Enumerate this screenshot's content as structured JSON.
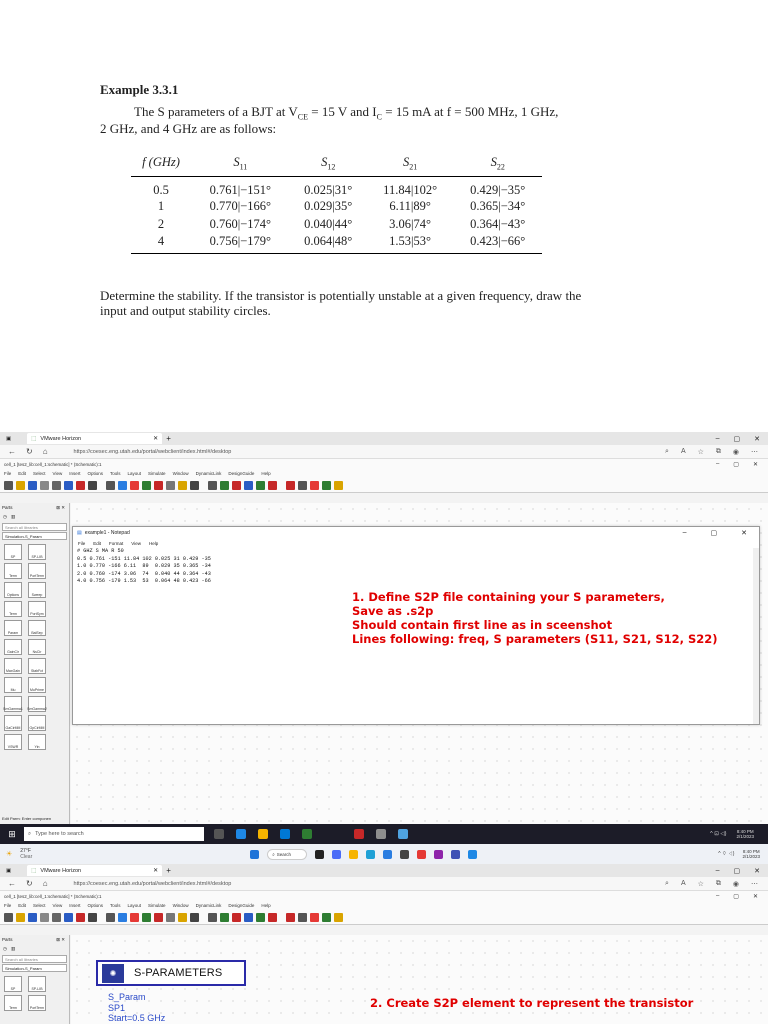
{
  "example": {
    "title": "Example 3.3.1",
    "intro_line1": "The S parameters of a BJT at V",
    "intro_vce_sub": "CE",
    "intro_mid": " = 15 V and I",
    "intro_ic_sub": "C",
    "intro_end": " = 15 mA at f = 500 MHz, 1 GHz,",
    "intro_line2": "2 GHz, and 4 GHz are as follows:",
    "table": {
      "headers": [
        "f (GHz)",
        "S11",
        "S12",
        "S21",
        "S22"
      ],
      "rows": [
        [
          "0.5",
          "0.761|−151°",
          "0.025|31°",
          "11.84|102°",
          "0.429|−35°"
        ],
        [
          "1",
          "0.770|−166°",
          "0.029|35°",
          "6.11|89°",
          "0.365|−34°"
        ],
        [
          "2",
          "0.760|−174°",
          "0.040|44°",
          "3.06|74°",
          "0.364|−43°"
        ],
        [
          "4",
          "0.756|−179°",
          "0.064|48°",
          "1.53|53°",
          "0.423|−66°"
        ]
      ]
    },
    "question": "Determine the stability. If the transistor is potentially unstable at a given frequency, draw the input and output stability circles."
  },
  "browser": {
    "tab_title": "VMware Horizon",
    "url": "https://coesec.eng.utah.edu/portal/webclient/index.html#/desktop"
  },
  "ads": {
    "window_title_1": "cell_1 [tes2_lib:cell_1:schematic] * (Schematic):1",
    "window_title_2": "cell_1 [tes2_lib:cell_1:schematic] * (Schematic):1",
    "menu": [
      "File",
      "Edit",
      "Select",
      "View",
      "Insert",
      "Options",
      "Tools",
      "Layout",
      "Simulate",
      "Window",
      "DynamicLink",
      "DesignGuide",
      "Help"
    ],
    "parts_label": "Parts",
    "search_placeholder": "Search all libraries",
    "palette_select": "Simulation-S_Param",
    "palette_items": [
      "SP",
      "SP-LIB",
      "Term",
      "PortTerm",
      "Options",
      "Sweep",
      "Term",
      "PortSym",
      "Param",
      "BalSep",
      "GainCir",
      "NsCir",
      "MaxGain",
      "StabFct",
      "Mu",
      "MuPrime",
      "SmGamma1",
      "SmGamma2",
      "GaCirMM",
      "GpCirMM",
      "VSWR",
      "Yin"
    ],
    "status_text": "Edit Parm: Enter componen"
  },
  "notepad": {
    "title": "example1 - Notepad",
    "menu": [
      "File",
      "Edit",
      "Format",
      "View",
      "Help"
    ],
    "lines": [
      "# GHZ S MA R 50",
      "0.5 0.761 -151 11.84 102 0.025 31 0.429 -35",
      "1.0 0.770 -166 6.11  89  0.029 35 0.365 -34",
      "2.0 0.760 -174 3.06  74  0.040 44 0.364 -43",
      "4.0 0.756 -179 1.53  53  0.064 48 0.423 -66"
    ]
  },
  "note1": {
    "line1": "1.   Define S2P file containing your S parameters,",
    "line2": "Save as .s2p",
    "line3": "Should contain first line as in sceenshot",
    "line4": "Lines following: freq, S parameters (S11, S21, S12, S22)"
  },
  "taskbar": {
    "search_placeholder": "Type here to search",
    "time": "8:40 PM",
    "date": "2/1/2023"
  },
  "taskbar2": {
    "temp": "27°F",
    "weather": "Clear",
    "search": "Search",
    "time": "8:40 PM",
    "date": "2/1/2023"
  },
  "schematic": {
    "block_title": "S-PARAMETERS",
    "line1": "S_Param",
    "line2": "SP1",
    "line3": "Start=0.5 GHz"
  },
  "note2": "2. Create S2P element to represent the transistor",
  "colors": {
    "annotation_red": "#e00000",
    "ads_blue": "#2a2aa8"
  }
}
